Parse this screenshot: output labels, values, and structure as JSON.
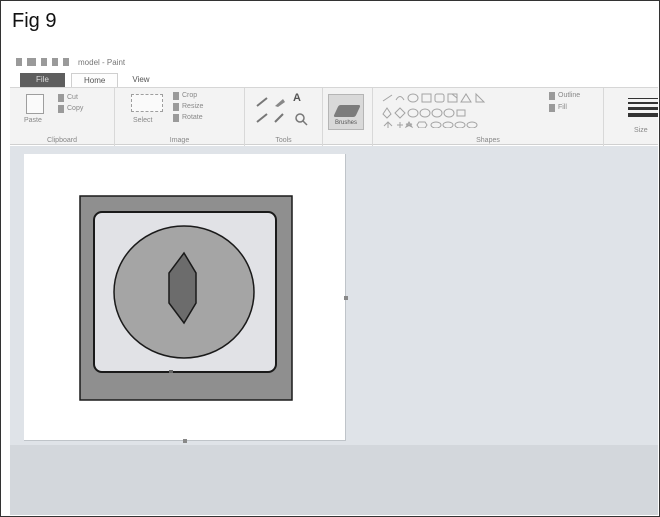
{
  "figure": {
    "label": "Fig 9"
  },
  "window": {
    "title": "model - Paint"
  },
  "tabs": [
    {
      "label": "File"
    },
    {
      "label": "Home"
    },
    {
      "label": "View"
    }
  ],
  "ribbon": {
    "clipboard": {
      "paste": "Paste",
      "cut": "Cut",
      "copy": "Copy",
      "group": "Clipboard"
    },
    "image": {
      "select": "Select",
      "crop": "Crop",
      "resize": "Resize",
      "rotate": "Rotate",
      "group": "Image"
    },
    "tools": {
      "group": "Tools",
      "text_tool": "A"
    },
    "brushes": {
      "label": "Brushes"
    },
    "shapes": {
      "outline": "Outline",
      "fill": "Fill",
      "group": "Shapes"
    },
    "size": {
      "label": "Size"
    }
  },
  "drawing": {
    "outer_square_color": "#8f8f8f",
    "inner_square_color": "#e1e2e6",
    "circle_color": "#a5a5a5",
    "hexagon_color": "#6c6c6c",
    "outline_color": "#1a1a1a"
  },
  "colors": {
    "file_tab": "#5e5e5e",
    "ribbon": "#f3f3f3",
    "workspace": "#dfe3e8"
  }
}
